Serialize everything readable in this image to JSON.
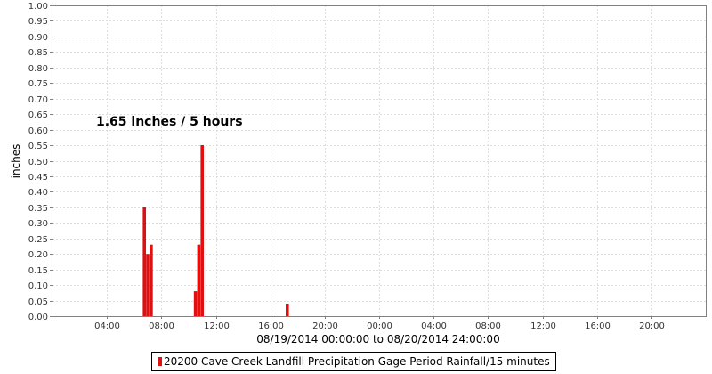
{
  "chart_data": {
    "type": "bar",
    "ylabel": "inches",
    "xlabel": "08/19/2014 00:00:00 to 08/20/2014 24:00:00",
    "annotation": "1.65 inches / 5 hours",
    "ylim": [
      0,
      1.0
    ],
    "xlim_hours": [
      0,
      48
    ],
    "y_ticks": [
      "0.00",
      "0.05",
      "0.10",
      "0.15",
      "0.20",
      "0.25",
      "0.30",
      "0.35",
      "0.40",
      "0.45",
      "0.50",
      "0.55",
      "0.60",
      "0.65",
      "0.70",
      "0.75",
      "0.80",
      "0.85",
      "0.90",
      "0.95",
      "1.00"
    ],
    "x_ticks": [
      {
        "hour": 4,
        "label": "04:00"
      },
      {
        "hour": 8,
        "label": "08:00"
      },
      {
        "hour": 12,
        "label": "12:00"
      },
      {
        "hour": 16,
        "label": "16:00"
      },
      {
        "hour": 20,
        "label": "20:00"
      },
      {
        "hour": 24,
        "label": "00:00"
      },
      {
        "hour": 28,
        "label": "04:00"
      },
      {
        "hour": 32,
        "label": "08:00"
      },
      {
        "hour": 36,
        "label": "12:00"
      },
      {
        "hour": 40,
        "label": "16:00"
      },
      {
        "hour": 44,
        "label": "20:00"
      }
    ],
    "series": [
      {
        "name": "20200 Cave Creek Landfill Precipitation Gage Period Rainfall/15 minutes",
        "color": "#e01010",
        "points": [
          {
            "time": "08/19/2014 06:45",
            "hour": 6.75,
            "value": 0.35
          },
          {
            "time": "08/19/2014 07:00",
            "hour": 7.0,
            "value": 0.2
          },
          {
            "time": "08/19/2014 07:15",
            "hour": 7.25,
            "value": 0.23
          },
          {
            "time": "08/19/2014 10:30",
            "hour": 10.5,
            "value": 0.08
          },
          {
            "time": "08/19/2014 10:45",
            "hour": 10.75,
            "value": 0.23
          },
          {
            "time": "08/19/2014 11:00",
            "hour": 11.0,
            "value": 0.55
          },
          {
            "time": "08/19/2014 17:15",
            "hour": 17.25,
            "value": 0.04
          }
        ]
      }
    ],
    "grid": true,
    "legend_position": "bottom"
  }
}
